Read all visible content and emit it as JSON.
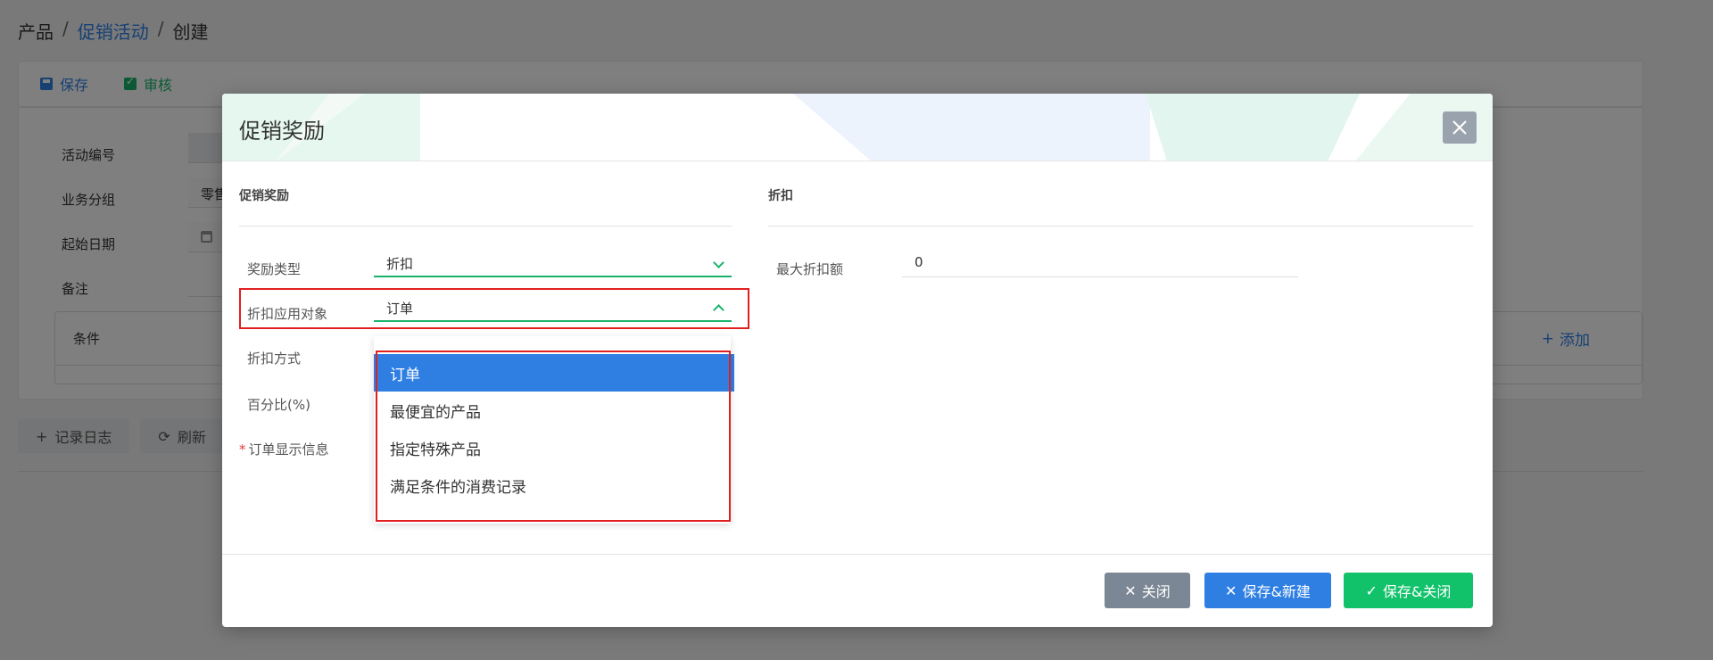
{
  "breadcrumb": {
    "root": "产品",
    "parent": "促销活动",
    "current": "创建"
  },
  "toolbar": {
    "save_label": "保存",
    "audit_label": "审核"
  },
  "background_form": {
    "activity_no_label": "活动编号",
    "group_label": "业务分组",
    "group_value": "零售",
    "start_date_label": "起始日期",
    "remark_label": "备注",
    "conditions_title": "条件",
    "add_label": "添加"
  },
  "bottom_bar": {
    "log_label": "记录日志",
    "refresh_label": "刷新"
  },
  "modal": {
    "title": "促销奖励",
    "left_section_title": "促销奖励",
    "right_section_title": "折扣",
    "fields": {
      "reward_type_label": "奖励类型",
      "reward_type_value": "折扣",
      "apply_target_label": "折扣应用对象",
      "apply_target_value": "订单",
      "discount_method_label": "折扣方式",
      "percent_label": "百分比(%)",
      "order_display_label": "订单显示信息",
      "max_discount_label": "最大折扣额",
      "max_discount_value": "0"
    },
    "dropdown_options": [
      "订单",
      "最便宜的产品",
      "指定特殊产品",
      "满足条件的消费记录"
    ],
    "dropdown_selected_index": 0,
    "footer": {
      "close_label": "关闭",
      "save_new_label": "保存&新建",
      "save_close_label": "保存&关闭"
    }
  },
  "colors": {
    "primary": "#2f7fe3",
    "success": "#12c26b",
    "highlight": "#e02020",
    "gray_btn": "#7b8794"
  }
}
